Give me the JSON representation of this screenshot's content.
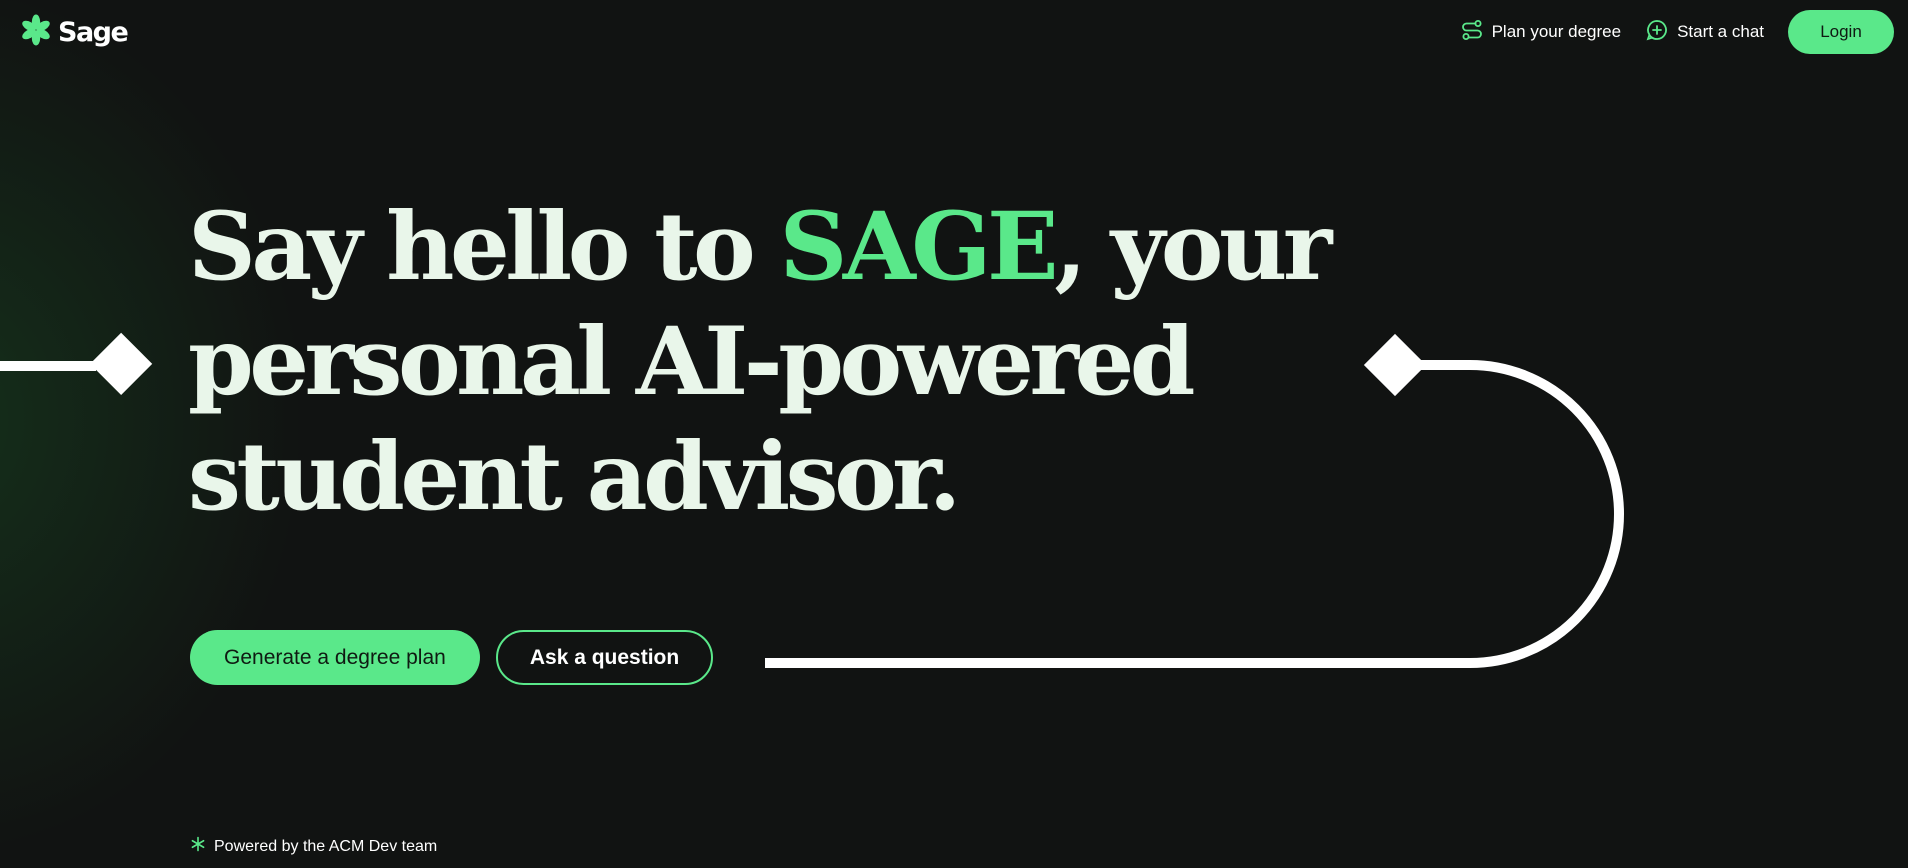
{
  "brand": {
    "name": "Sage",
    "logo_icon": "asterisk-flower-icon",
    "accent_color": "#5ae88a",
    "background_color": "#111312"
  },
  "nav": {
    "plan_label": "Plan your degree",
    "plan_icon": "route-icon",
    "chat_label": "Start a chat",
    "chat_icon": "chat-plus-icon",
    "login_label": "Login"
  },
  "hero": {
    "headline_part1": "Say hello to ",
    "headline_accent": "SAGE",
    "headline_part2": ", your personal AI-powered student advisor.",
    "primary_cta": "Generate a degree plan",
    "secondary_cta": "Ask a question"
  },
  "footer": {
    "powered_by": "Powered by the ACM Dev team",
    "icon": "asterisk-icon"
  }
}
